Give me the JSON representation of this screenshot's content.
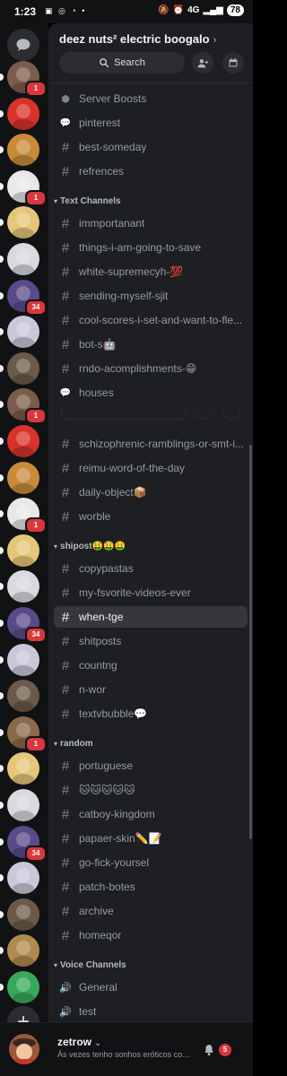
{
  "status_bar": {
    "time": "1:23",
    "network": "4G",
    "battery": "78"
  },
  "server": {
    "name": "deez nuts² electric boogalo",
    "search_label": "Search"
  },
  "channels": [
    {
      "kind": "special",
      "icon": "shield",
      "label": "Server Boosts"
    },
    {
      "kind": "forum",
      "label": "pinterest"
    },
    {
      "kind": "text",
      "label": "best-someday"
    },
    {
      "kind": "text",
      "label": "refrences"
    },
    {
      "kind": "category",
      "label": "Text Channels"
    },
    {
      "kind": "text",
      "label": "immportanant"
    },
    {
      "kind": "text",
      "label": "things-i-am-going-to-save"
    },
    {
      "kind": "text",
      "label": "white-supremecyh-💯"
    },
    {
      "kind": "text",
      "label": "sending-myself-sjit"
    },
    {
      "kind": "text",
      "label": "cool-scores-i-set-and-want-to-fle..."
    },
    {
      "kind": "text",
      "label": "bot-s🤖"
    },
    {
      "kind": "text",
      "label": "rndo-acomplishments-😁"
    },
    {
      "kind": "forum",
      "label": "houses"
    },
    {
      "kind": "text",
      "label": "schizophrenic-ramblings-or-smt-i..."
    },
    {
      "kind": "text",
      "label": "reimu-word-of-the-day"
    },
    {
      "kind": "text",
      "label": "daily-object📦"
    },
    {
      "kind": "text",
      "label": "worble"
    },
    {
      "kind": "category",
      "label": "shipost🤑🤑🤑"
    },
    {
      "kind": "text",
      "label": "copypastas"
    },
    {
      "kind": "text",
      "label": "my-fsvorite-videos-ever"
    },
    {
      "kind": "text",
      "label": "when-tge",
      "active": true
    },
    {
      "kind": "text",
      "label": "shitposts"
    },
    {
      "kind": "text",
      "label": "countng"
    },
    {
      "kind": "text",
      "label": "n-wor"
    },
    {
      "kind": "text",
      "label": "textvbubble💬"
    },
    {
      "kind": "category",
      "label": "random"
    },
    {
      "kind": "text",
      "label": "portuguese"
    },
    {
      "kind": "text",
      "label": "🐱🐱🐱🐱🐱"
    },
    {
      "kind": "text",
      "label": "catboy-kingdom"
    },
    {
      "kind": "text",
      "label": "papaer-skin✏️📝"
    },
    {
      "kind": "text",
      "label": "go-fick-yoursel"
    },
    {
      "kind": "text",
      "label": "patch-botes"
    },
    {
      "kind": "text",
      "label": "archive"
    },
    {
      "kind": "text",
      "label": "homeqor"
    },
    {
      "kind": "category",
      "label": "Voice Channels"
    },
    {
      "kind": "voice",
      "label": "General"
    },
    {
      "kind": "voice",
      "label": "test"
    }
  ],
  "rail_servers": [
    {
      "color": "#7a5c4a",
      "badge": "1"
    },
    {
      "color": "#d8322b",
      "badge": ""
    },
    {
      "color": "#c98a3a",
      "badge": ""
    },
    {
      "color": "#e8e8e8",
      "badge": "1"
    },
    {
      "color": "#e6c77a",
      "badge": ""
    },
    {
      "color": "#d9d9de",
      "badge": ""
    },
    {
      "color": "#5a4a8a",
      "badge": "34"
    },
    {
      "color": "#c9c7d8",
      "badge": ""
    },
    {
      "color": "#6b5a4a",
      "badge": ""
    },
    {
      "color": "#7a5c4a",
      "badge": "1"
    },
    {
      "color": "#d8322b",
      "badge": ""
    },
    {
      "color": "#c98a3a",
      "badge": ""
    },
    {
      "color": "#e8e8e8",
      "badge": "1"
    },
    {
      "color": "#e6c77a",
      "badge": ""
    },
    {
      "color": "#d9d9de",
      "badge": ""
    },
    {
      "color": "#5a4a8a",
      "badge": "34"
    },
    {
      "color": "#c9c7d8",
      "badge": ""
    },
    {
      "color": "#6b5a4a",
      "badge": ""
    },
    {
      "color": "#8a6a4a",
      "badge": "1"
    },
    {
      "color": "#e6c77a",
      "badge": ""
    },
    {
      "color": "#d9d9de",
      "badge": ""
    },
    {
      "color": "#5a4a8a",
      "badge": "34"
    },
    {
      "color": "#c9c7d8",
      "badge": ""
    },
    {
      "color": "#6b5a4a",
      "badge": ""
    },
    {
      "color": "#b08a50",
      "badge": ""
    },
    {
      "color": "#3aa85a",
      "badge": ""
    }
  ],
  "user": {
    "name": "zetrow",
    "status": "Ás vezes tenho sonhos eróticos com P...",
    "notifications": "5"
  },
  "colors": {
    "panel_bg": "#1e1f22",
    "rail_bg": "#111214",
    "active_bg": "#35373c",
    "badge_red": "#da373c"
  }
}
